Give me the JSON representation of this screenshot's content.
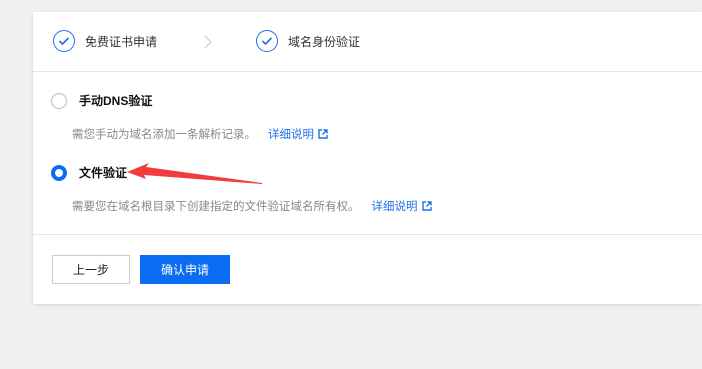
{
  "steps": [
    {
      "label": "免费证书申请",
      "icon": "check-icon"
    },
    {
      "label": "域名身份验证",
      "icon": "check-icon"
    }
  ],
  "options": [
    {
      "title": "手动DNS验证",
      "description": "需您手动为域名添加一条解析记录。",
      "link": "详细说明",
      "selected": false
    },
    {
      "title": "文件验证",
      "description": "需要您在域名根目录下创建指定的文件验证域名所有权。",
      "link": "详细说明",
      "selected": true
    }
  ],
  "buttons": {
    "prev": "上一步",
    "confirm": "确认申请"
  },
  "colors": {
    "accent": "#0a6cf0",
    "annotation_arrow": "#f03c3c",
    "background": "#f0f0f0"
  }
}
